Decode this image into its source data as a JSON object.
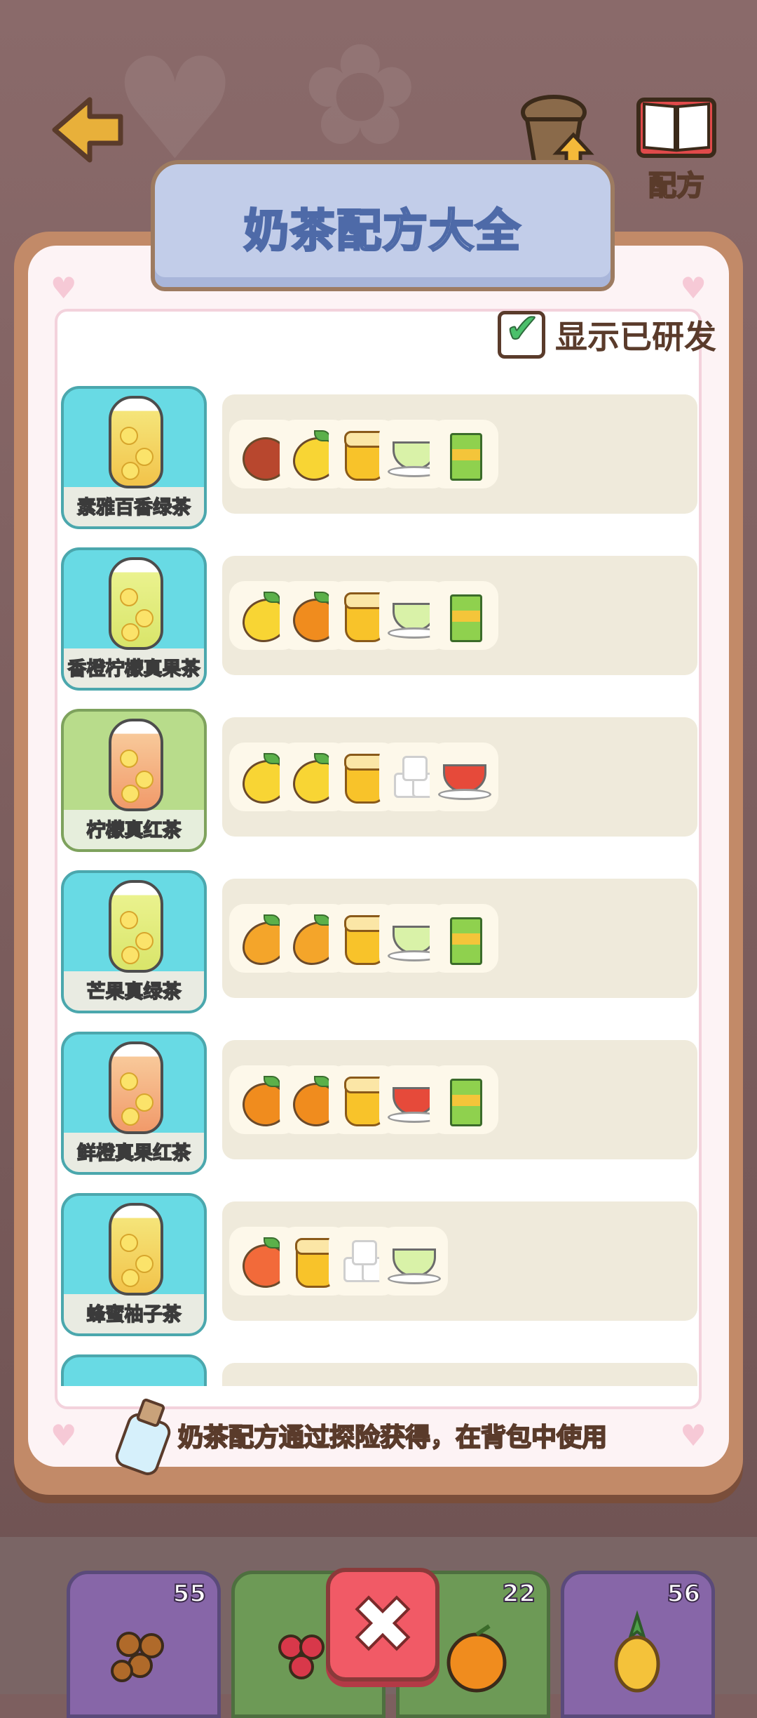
{
  "title": "奶茶配方大全",
  "top_bar": {
    "upgrade_label": "升级",
    "recipe_label": "配方"
  },
  "filter": {
    "show_developed_label": "显示已研发",
    "checked": true
  },
  "recipes": [
    {
      "name": "素雅百香绿茶",
      "card": "blue",
      "drink": "yellow",
      "ingredients": [
        "passionfruit-icon",
        "lemon-icon",
        "honey-jar-icon",
        "green-tea-icon",
        "juice-box-icon"
      ]
    },
    {
      "name": "香橙柠檬真果茶",
      "card": "blue",
      "drink": "lime",
      "ingredients": [
        "lemon-icon",
        "orange-icon",
        "honey-jar-icon",
        "green-tea-icon",
        "juice-box-icon"
      ]
    },
    {
      "name": "柠檬真红茶",
      "card": "green",
      "drink": "peach",
      "ingredients": [
        "lemon-icon",
        "lemon-icon",
        "honey-jar-icon",
        "sugar-cubes-icon",
        "black-tea-icon"
      ]
    },
    {
      "name": "芒果真绿茶",
      "card": "blue",
      "drink": "lime",
      "ingredients": [
        "mango-icon",
        "mango-icon",
        "honey-jar-icon",
        "green-tea-icon",
        "juice-box-icon"
      ]
    },
    {
      "name": "鲜橙真果红茶",
      "card": "blue",
      "drink": "peach",
      "ingredients": [
        "orange-icon",
        "orange-icon",
        "honey-jar-icon",
        "black-tea-icon",
        "juice-box-icon"
      ]
    },
    {
      "name": "蜂蜜柚子茶",
      "card": "blue",
      "drink": "yellow",
      "ingredients": [
        "grapefruit-icon",
        "honey-jar-icon",
        "sugar-cubes-icon",
        "green-tea-icon"
      ]
    }
  ],
  "footer_tip": "奶茶配方通过探险获得，在背包中使用",
  "inventory": [
    {
      "item": "boba-icon",
      "count": "55"
    },
    {
      "item": "raspberry-icon",
      "count": ""
    },
    {
      "item": "orange-icon",
      "count": "22"
    },
    {
      "item": "pineapple-icon",
      "count": "56"
    }
  ],
  "colors": {
    "card_blue": "#68dae4",
    "card_green": "#b8dc8b",
    "title_tab": "#c2cde9",
    "close_button": "#f15a66"
  }
}
